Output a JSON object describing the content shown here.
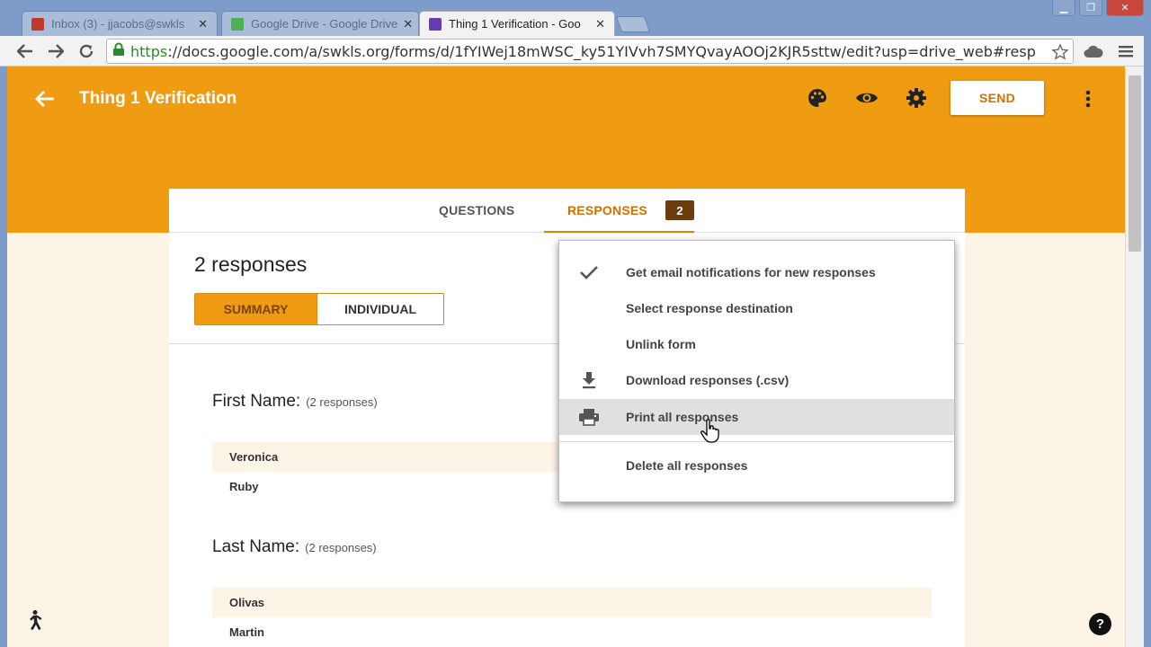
{
  "browser": {
    "tabs": [
      {
        "label": "Inbox (3) - jjacobs@swkls"
      },
      {
        "label": "Google Drive - Google Drive"
      },
      {
        "label": "Thing 1 Verification - Goo"
      }
    ],
    "url_scheme": "https",
    "url_rest": "://docs.google.com/a/swkls.org/forms/d/1fYIWej18mWSC_ky51YIVvh7SMYQvayAOOj2KJR5sttw/edit?usp=drive_web#resp"
  },
  "header": {
    "title": "Thing 1 Verification",
    "send_label": "SEND",
    "accent_color": "#f09c13"
  },
  "tabs": {
    "questions_label": "QUESTIONS",
    "responses_label": "RESPONSES",
    "responses_count": "2"
  },
  "summary": {
    "heading": "2 responses",
    "summary_label": "SUMMARY",
    "individual_label": "INDIVIDUAL"
  },
  "questions": [
    {
      "title": "First Name:",
      "count": "(2 responses)",
      "answers": [
        "Veronica",
        "Ruby"
      ]
    },
    {
      "title": "Last Name:",
      "count": "(2 responses)",
      "answers": [
        "Olivas",
        "Martin"
      ]
    }
  ],
  "menu": {
    "items": [
      {
        "label": "Get email notifications for new responses",
        "icon": "check-icon"
      },
      {
        "label": "Select response destination",
        "icon": ""
      },
      {
        "label": "Unlink form",
        "icon": ""
      },
      {
        "label": "Download responses (.csv)",
        "icon": "download-icon"
      },
      {
        "label": "Print all responses",
        "icon": "print-icon"
      },
      {
        "label": "Delete all responses",
        "icon": ""
      }
    ]
  },
  "help_label": "?"
}
